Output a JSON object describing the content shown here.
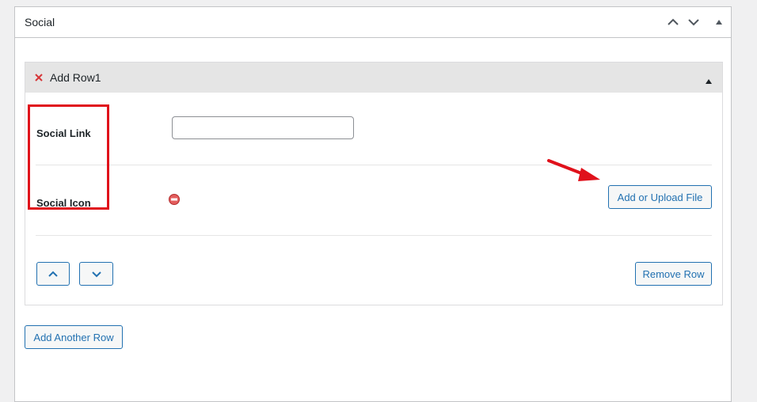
{
  "metabox": {
    "title": "Social",
    "controls": [
      "chevron-up-icon",
      "chevron-down-icon",
      "triangle-up-icon"
    ]
  },
  "group": {
    "title": "Add Row1",
    "fields": {
      "social_link_label": "Social Link",
      "social_link_value": "",
      "social_icon_label": "Social Icon"
    },
    "upload_button": "Add or Upload File",
    "remove_row_button": "Remove Row"
  },
  "add_another_row_button": "Add Another Row",
  "colors": {
    "accent": "#2271b1",
    "annotation": "#e0111b",
    "delete": "#d63638"
  }
}
